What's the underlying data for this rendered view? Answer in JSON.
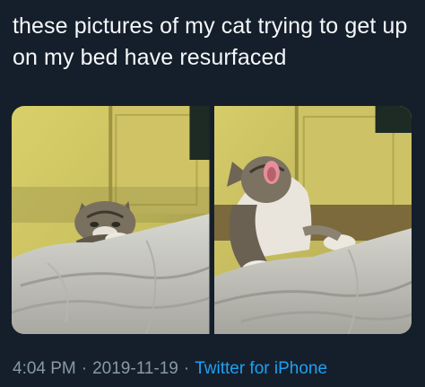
{
  "tweet": {
    "text": "these pictures of my cat trying to get up on my bed have resurfaced",
    "time": "4:04 PM",
    "separator": "·",
    "date": "2019-11-19",
    "source": "Twitter for iPhone"
  },
  "media": [
    {
      "icon": "kitten-peeking-over-bed-photo"
    },
    {
      "icon": "kitten-yawning-on-bed-photo"
    }
  ],
  "colors": {
    "background": "#151f2b",
    "text": "#f5f8fa",
    "meta": "#8899a6",
    "link": "#1da1f2"
  }
}
